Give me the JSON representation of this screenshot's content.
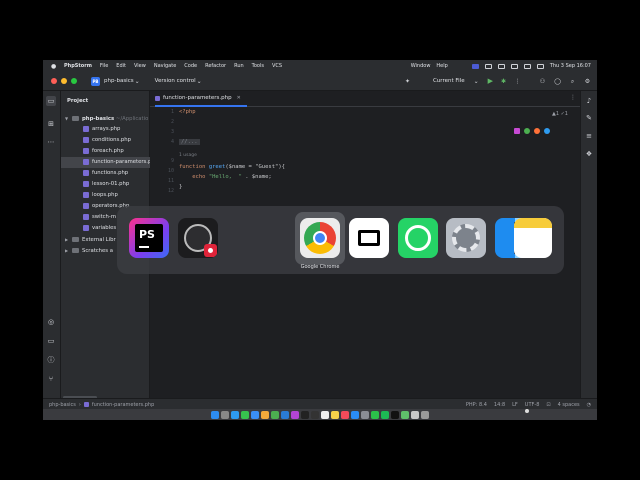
{
  "menubar": {
    "app_name": "PhpStorm",
    "items": [
      "File",
      "Edit",
      "View",
      "Navigate",
      "Code",
      "Refactor",
      "Run",
      "Tools",
      "VCS"
    ],
    "right_items": [
      "Window",
      "Help"
    ],
    "clock": "Thu 3 Sep  16:07"
  },
  "toolbar": {
    "project_badge": "PB",
    "project_name": "php-basics",
    "vcs_label": "Version control",
    "run_config": "Current File"
  },
  "project_panel": {
    "title": "Project",
    "root": "php-basics",
    "root_path": "~/Applicatio",
    "files": [
      "arrays.php",
      "conditions.php",
      "foreach.php",
      "function-parameters.php",
      "functions.php",
      "lesson-01.php",
      "loops.php",
      "operators.php",
      "switch-m",
      "variables"
    ],
    "selected_index": 3,
    "external": "External Libr",
    "scratches": "Scratches a"
  },
  "editor": {
    "tab_label": "function-parameters.php",
    "warnings": "▲1 ✓1",
    "line_numbers": [
      "1",
      "2",
      "3",
      "4",
      "",
      "9",
      "10",
      "11",
      "12"
    ],
    "lines": {
      "open_tag": "<?php",
      "fold": "//...",
      "usage_hint": "1 usage",
      "fn_kw": "function ",
      "fn_name": "greet",
      "fn_params": "($name = \"Guest\"){",
      "echo_kw": "    echo ",
      "echo_str": "\"Hello,  \"",
      "echo_rest": ". $name;",
      "close_brace": "}"
    }
  },
  "switcher": {
    "apps": [
      "PhpStorm",
      "OBS Studio",
      "Google Chrome",
      "CapCut",
      "WhatsApp",
      "System Settings",
      "Finder",
      "Notes"
    ],
    "selected_label": "Google Chrome",
    "phpstorm_glyph": "PS"
  },
  "statusbar": {
    "breadcrumb_root": "php-basics",
    "breadcrumb_file": "function-parameters.php",
    "php_version": "PHP: 8.4",
    "position": "14:8",
    "line_sep": "LF",
    "encoding": "UTF-8",
    "indent": "4 spaces"
  },
  "colors": {
    "accent": "#3574f0",
    "editor_bg": "#1e1f22",
    "panel_bg": "#2b2d30"
  }
}
